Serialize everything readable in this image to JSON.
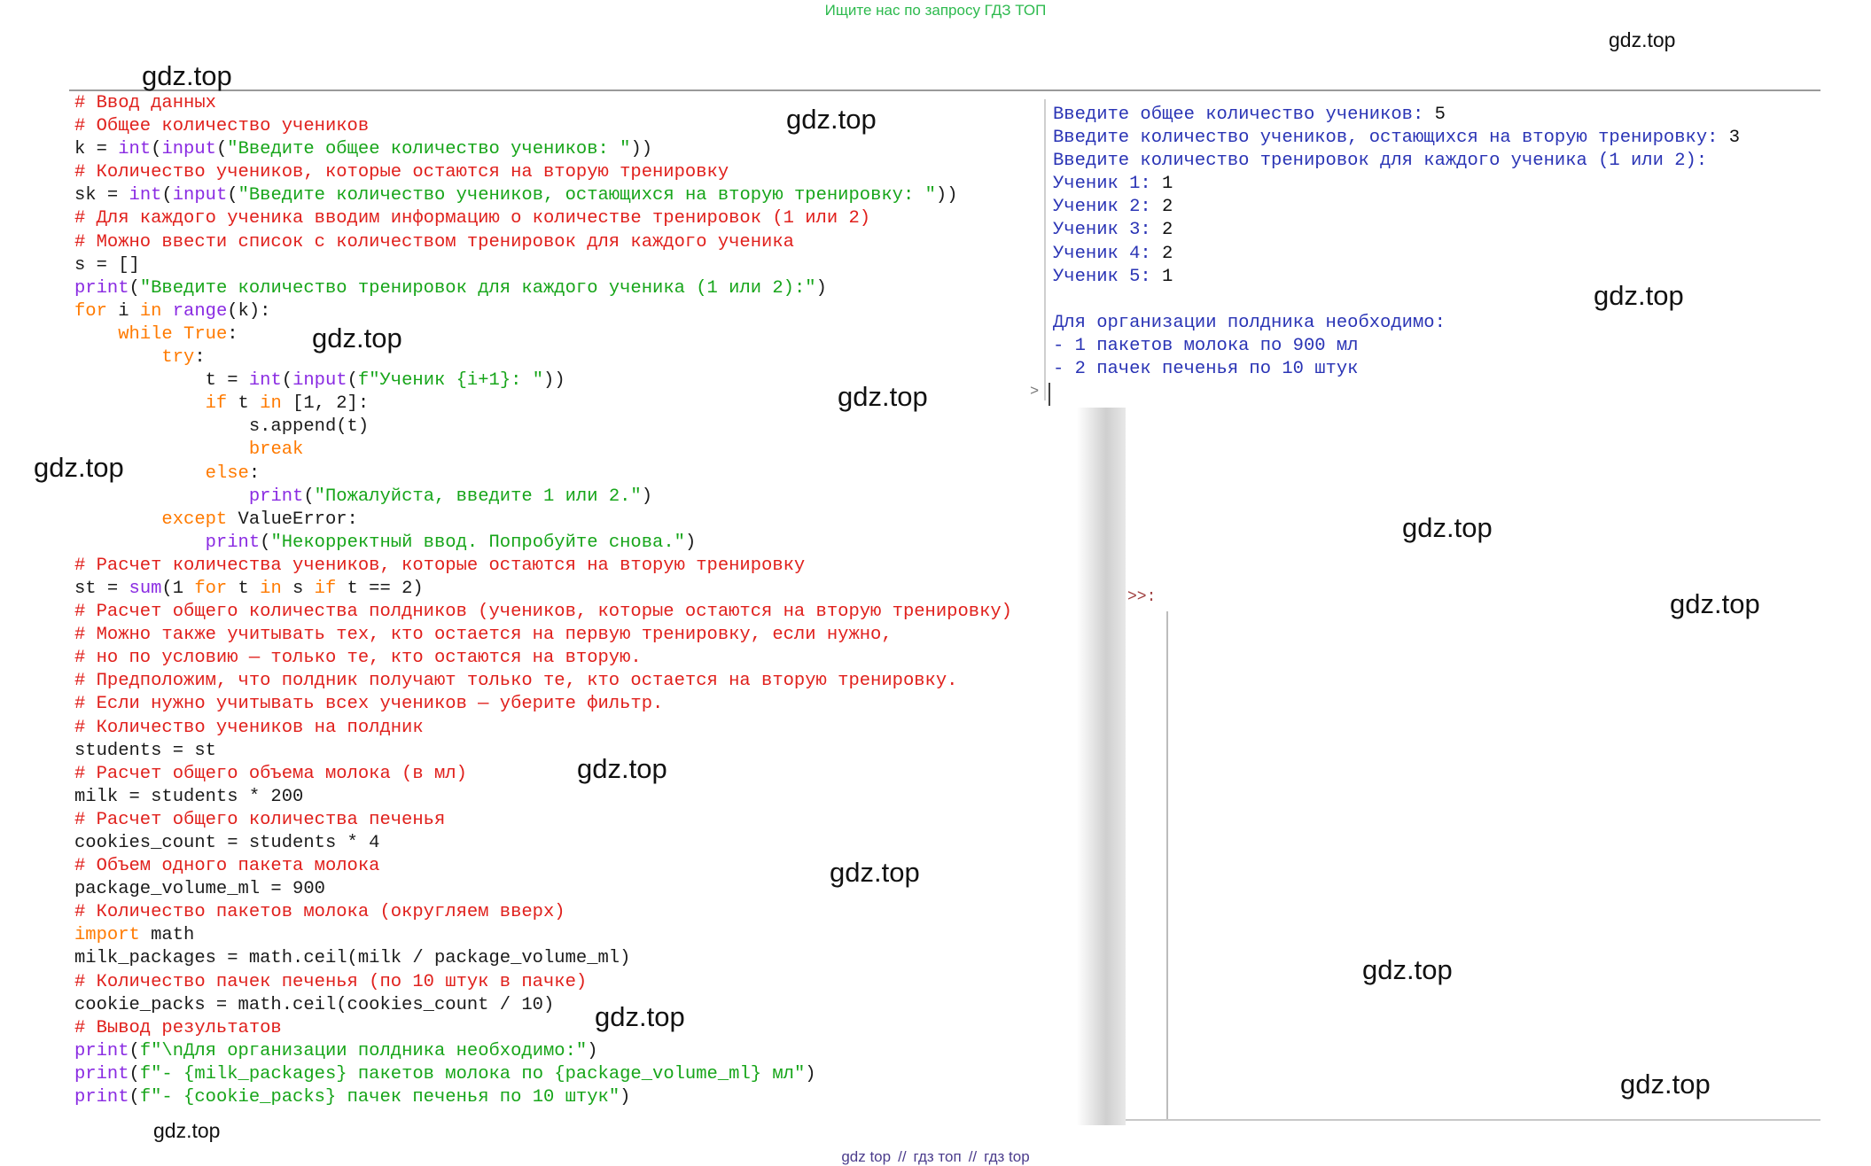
{
  "banner": "Ищите нас по запросу ГДЗ ТОП",
  "watermark": "gdz.top",
  "code_lines": [
    [
      {
        "t": "# Ввод данных",
        "k": "c"
      }
    ],
    [
      {
        "t": "# Общее количество учеников",
        "k": "c"
      }
    ],
    [
      {
        "t": "k = "
      },
      {
        "t": "int",
        "k": "b"
      },
      {
        "t": "("
      },
      {
        "t": "input",
        "k": "b"
      },
      {
        "t": "("
      },
      {
        "t": "\"Введите общее количество учеников: \"",
        "k": "s"
      },
      {
        "t": "))"
      }
    ],
    [
      {
        "t": "# Количество учеников, которые остаются на вторую тренировку",
        "k": "c"
      }
    ],
    [
      {
        "t": "sk = "
      },
      {
        "t": "int",
        "k": "b"
      },
      {
        "t": "("
      },
      {
        "t": "input",
        "k": "b"
      },
      {
        "t": "("
      },
      {
        "t": "\"Введите количество учеников, остающихся на вторую тренировку: \"",
        "k": "s"
      },
      {
        "t": "))"
      }
    ],
    [
      {
        "t": "# Для каждого ученика вводим информацию о количестве тренировок (1 или 2)",
        "k": "c"
      }
    ],
    [
      {
        "t": "# Можно ввести список с количеством тренировок для каждого ученика",
        "k": "c"
      }
    ],
    [
      {
        "t": "s = []"
      }
    ],
    [
      {
        "t": "print",
        "k": "b"
      },
      {
        "t": "("
      },
      {
        "t": "\"Введите количество тренировок для каждого ученика (1 или 2):\"",
        "k": "s"
      },
      {
        "t": ")"
      }
    ],
    [
      {
        "t": "for",
        "k": "k"
      },
      {
        "t": " i "
      },
      {
        "t": "in",
        "k": "k"
      },
      {
        "t": " "
      },
      {
        "t": "range",
        "k": "b"
      },
      {
        "t": "(k):"
      }
    ],
    [
      {
        "t": "    "
      },
      {
        "t": "while",
        "k": "k"
      },
      {
        "t": " "
      },
      {
        "t": "True",
        "k": "k"
      },
      {
        "t": ":"
      }
    ],
    [
      {
        "t": "        "
      },
      {
        "t": "try",
        "k": "k"
      },
      {
        "t": ":"
      }
    ],
    [
      {
        "t": "            t = "
      },
      {
        "t": "int",
        "k": "b"
      },
      {
        "t": "("
      },
      {
        "t": "input",
        "k": "b"
      },
      {
        "t": "("
      },
      {
        "t": "f\"Ученик {i+1}: \"",
        "k": "s"
      },
      {
        "t": "))"
      }
    ],
    [
      {
        "t": "            "
      },
      {
        "t": "if",
        "k": "k"
      },
      {
        "t": " t "
      },
      {
        "t": "in",
        "k": "k"
      },
      {
        "t": " [1, 2]:"
      }
    ],
    [
      {
        "t": "                s.append(t)"
      }
    ],
    [
      {
        "t": "                "
      },
      {
        "t": "break",
        "k": "k"
      }
    ],
    [
      {
        "t": "            "
      },
      {
        "t": "else",
        "k": "k"
      },
      {
        "t": ":"
      }
    ],
    [
      {
        "t": "                "
      },
      {
        "t": "print",
        "k": "b"
      },
      {
        "t": "("
      },
      {
        "t": "\"Пожалуйста, введите 1 или 2.\"",
        "k": "s"
      },
      {
        "t": ")"
      }
    ],
    [
      {
        "t": "        "
      },
      {
        "t": "except",
        "k": "k"
      },
      {
        "t": " ValueError:"
      }
    ],
    [
      {
        "t": "            "
      },
      {
        "t": "print",
        "k": "b"
      },
      {
        "t": "("
      },
      {
        "t": "\"Некорректный ввод. Попробуйте снова.\"",
        "k": "s"
      },
      {
        "t": ")"
      }
    ],
    [
      {
        "t": "# Расчет количества учеников, которые остаются на вторую тренировку",
        "k": "c"
      }
    ],
    [
      {
        "t": "st = "
      },
      {
        "t": "sum",
        "k": "b"
      },
      {
        "t": "(1 "
      },
      {
        "t": "for",
        "k": "k"
      },
      {
        "t": " t "
      },
      {
        "t": "in",
        "k": "k"
      },
      {
        "t": " s "
      },
      {
        "t": "if",
        "k": "k"
      },
      {
        "t": " t == 2)"
      }
    ],
    [
      {
        "t": "# Расчет общего количества полдников (учеников, которые остаются на вторую тренировку)",
        "k": "c"
      }
    ],
    [
      {
        "t": "# Можно также учитывать тех, кто остается на первую тренировку, если нужно,",
        "k": "c"
      }
    ],
    [
      {
        "t": "# но по условию — только те, кто остаются на вторую.",
        "k": "c"
      }
    ],
    [
      {
        "t": "# Предположим, что полдник получают только те, кто остается на вторую тренировку.",
        "k": "c"
      }
    ],
    [
      {
        "t": "# Если нужно учитывать всех учеников — уберите фильтр.",
        "k": "c"
      }
    ],
    [
      {
        "t": "# Количество учеников на полдник",
        "k": "c"
      }
    ],
    [
      {
        "t": "students = st"
      }
    ],
    [
      {
        "t": "# Расчет общего объема молока (в мл)",
        "k": "c"
      }
    ],
    [
      {
        "t": "milk = students * 200"
      }
    ],
    [
      {
        "t": "# Расчет общего количества печенья",
        "k": "c"
      }
    ],
    [
      {
        "t": "cookies_count = students * 4"
      }
    ],
    [
      {
        "t": "# Объем одного пакета молока",
        "k": "c"
      }
    ],
    [
      {
        "t": "package_volume_ml = 900"
      }
    ],
    [
      {
        "t": "# Количество пакетов молока (округляем вверх)",
        "k": "c"
      }
    ],
    [
      {
        "t": "import",
        "k": "k"
      },
      {
        "t": " math"
      }
    ],
    [
      {
        "t": "milk_packages = math.ceil(milk / package_volume_ml)"
      }
    ],
    [
      {
        "t": "# Количество пачек печенья (по 10 штук в пачке)",
        "k": "c"
      }
    ],
    [
      {
        "t": "cookie_packs = math.ceil(cookies_count / 10)"
      }
    ],
    [
      {
        "t": "# Вывод результатов",
        "k": "c"
      }
    ],
    [
      {
        "t": "print",
        "k": "b"
      },
      {
        "t": "("
      },
      {
        "t": "f\"\\nДля организации полдника необходимо:\"",
        "k": "s"
      },
      {
        "t": ")"
      }
    ],
    [
      {
        "t": "print",
        "k": "b"
      },
      {
        "t": "("
      },
      {
        "t": "f\"- {milk_packages} пакетов молока по {package_volume_ml} мл\"",
        "k": "s"
      },
      {
        "t": ")"
      }
    ],
    [
      {
        "t": "print",
        "k": "b"
      },
      {
        "t": "("
      },
      {
        "t": "f\"- {cookie_packs} пачек печенья по 10 штук\"",
        "k": "s"
      },
      {
        "t": ")"
      }
    ]
  ],
  "shell_lines": [
    [
      {
        "t": "Введите общее количество учеников: "
      },
      {
        "t": "5",
        "k": "ans"
      }
    ],
    [
      {
        "t": "Введите количество учеников, остающихся на вторую тренировку: "
      },
      {
        "t": "3",
        "k": "ans"
      }
    ],
    [
      {
        "t": "Введите количество тренировок для каждого ученика (1 или 2):"
      }
    ],
    [
      {
        "t": "Ученик 1: "
      },
      {
        "t": "1",
        "k": "ans"
      }
    ],
    [
      {
        "t": "Ученик 2: "
      },
      {
        "t": "2",
        "k": "ans"
      }
    ],
    [
      {
        "t": "Ученик 3: "
      },
      {
        "t": "2",
        "k": "ans"
      }
    ],
    [
      {
        "t": "Ученик 4: "
      },
      {
        "t": "2",
        "k": "ans"
      }
    ],
    [
      {
        "t": "Ученик 5: "
      },
      {
        "t": "1",
        "k": "ans"
      }
    ],
    [
      {
        "t": ""
      }
    ],
    [
      {
        "t": "Для организации полдника необходимо:"
      }
    ],
    [
      {
        "t": "- 1 пакетов молока по 900 мл"
      }
    ],
    [
      {
        "t": "- 2 пачек печенья по 10 штук"
      }
    ]
  ],
  "shell": {
    "caret": ">",
    "prompt2": ">>:"
  },
  "footer": {
    "items": [
      "gdz top",
      "гдз топ",
      "гдз top"
    ],
    "sep": "//"
  },
  "colors": {
    "comment": "#e0201c",
    "keyword": "#ff7a00",
    "string": "#17a51a",
    "builtin": "#8a2be2",
    "shell_text": "#2a34b5"
  }
}
